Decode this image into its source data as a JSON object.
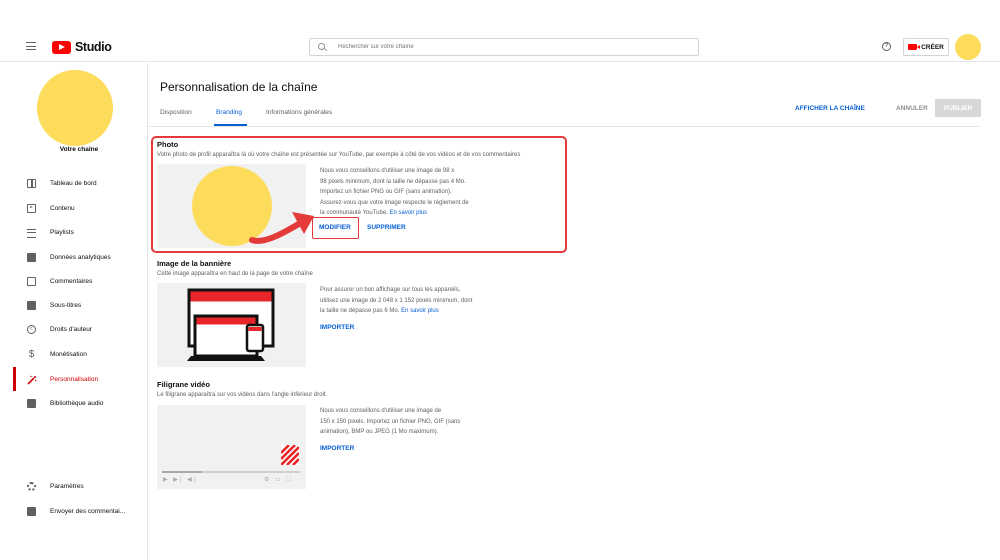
{
  "app": {
    "logo_text": "Studio"
  },
  "search": {
    "placeholder": "Rechercher sur votre chaîne"
  },
  "header": {
    "help_icon": "help-circle-icon",
    "create_label": "CRÉER"
  },
  "sidebar": {
    "channel_label": "Votre chaîne",
    "items": [
      {
        "label": "Tableau de bord",
        "icon": "dashboard-icon"
      },
      {
        "label": "Contenu",
        "icon": "content-icon"
      },
      {
        "label": "Playlists",
        "icon": "playlist-icon"
      },
      {
        "label": "Données analytiques",
        "icon": "analytics-icon"
      },
      {
        "label": "Commentaires",
        "icon": "comments-icon"
      },
      {
        "label": "Sous-titres",
        "icon": "subtitles-icon"
      },
      {
        "label": "Droits d'auteur",
        "icon": "copyright-icon"
      },
      {
        "label": "Monétisation",
        "icon": "monetization-icon"
      },
      {
        "label": "Personnalisation",
        "icon": "customization-icon",
        "active": true
      },
      {
        "label": "Bibliothèque audio",
        "icon": "audio-library-icon"
      }
    ],
    "bottom_items": [
      {
        "label": "Paramètres",
        "icon": "settings-icon"
      },
      {
        "label": "Envoyer des commentai...",
        "icon": "feedback-icon"
      }
    ]
  },
  "main": {
    "title": "Personnalisation de la chaîne",
    "tabs": [
      {
        "label": "Disposition"
      },
      {
        "label": "Branding",
        "active": true
      },
      {
        "label": "Informations générales"
      }
    ],
    "actions": {
      "view_channel": "AFFICHER LA CHAÎNE",
      "cancel": "ANNULER",
      "publish": "PUBLIER"
    },
    "photo": {
      "title": "Photo",
      "description": "Votre photo de profil apparaîtra là où votre chaîne est présentée sur YouTube, par exemple à côté de vos vidéos et de vos commentaires",
      "info_lines": [
        "Nous vous conseillons d'utiliser une image de 98 x",
        "98 pixels minimum, dont la taille ne dépasse pas 4 Mo.",
        "Importez un fichier PNG ou GIF (sans animation).",
        "Assurez-vous que votre image respecte le règlement de"
      ],
      "info_last": "la communauté YouTube.",
      "learn_more": "En savoir plus",
      "modify": "MODIFIER",
      "delete": "SUPPRIMER"
    },
    "banner": {
      "title": "Image de la bannière",
      "description": "Cette image apparaîtra en haut de la page de votre chaîne",
      "info_lines": [
        "Pour assurer un bon affichage sur tous les appareils,",
        "utilisez une image de 2 048 x 1 152 pixels minimum, dont"
      ],
      "info_last": "la taille ne dépasse pas 6 Mo.",
      "learn_more": "En savoir plus",
      "import": "IMPORTER"
    },
    "watermark": {
      "title": "Filigrane vidéo",
      "description": "Le filigrane apparaîtra sur vos vidéos dans l'angle inférieur droit.",
      "info_lines": [
        "Nous vous conseillons d'utiliser une image de",
        "150 x 150 pixels. Importez un fichier PNG, GIF (sans",
        "animation), BMP ou JPEG (1 Mo maximum)."
      ],
      "import": "IMPORTER",
      "player_left": "▶ ▶| ◀)",
      "player_right": "⚙ ▭ ⛶"
    }
  },
  "colors": {
    "brand_red": "#ff0000",
    "accent_blue": "#065fd4",
    "avatar_yellow": "#fddc5c",
    "highlight_red": "#e53a3a"
  }
}
